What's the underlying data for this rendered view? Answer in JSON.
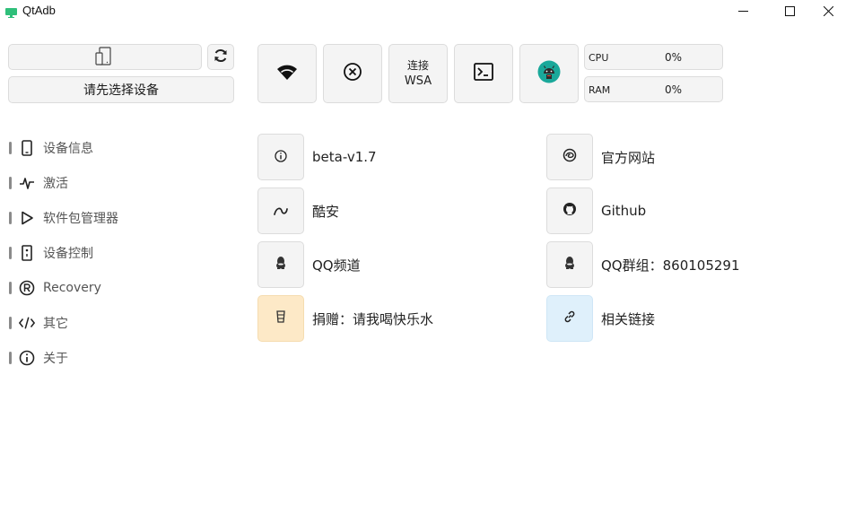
{
  "window": {
    "title": "QtAdb",
    "icon": "monitor-icon",
    "controls": [
      "minimize-icon",
      "maximize-icon",
      "close-icon"
    ]
  },
  "device": {
    "device_icon": "phone-outline-icon",
    "refresh_icon": "refresh-icon",
    "select_label": "请先选择设备"
  },
  "sidebar": {
    "items": [
      {
        "label": "设备信息",
        "icon": "phone-icon"
      },
      {
        "label": "激活",
        "icon": "pulse-icon"
      },
      {
        "label": "软件包管理器",
        "icon": "play-icon"
      },
      {
        "label": "设备控制",
        "icon": "remote-icon"
      },
      {
        "label": "Recovery",
        "icon": "registered-icon"
      },
      {
        "label": "其它",
        "icon": "code-icon"
      },
      {
        "label": "关于",
        "icon": "info-icon"
      }
    ]
  },
  "toolbar": {
    "wifi_icon": "wifi-icon",
    "disconnect_icon": "close-circle-icon",
    "wsa_line1": "连接",
    "wsa_line2": "WSA",
    "terminal_icon": "terminal-icon",
    "android_icon": "android-head-icon"
  },
  "stats": {
    "cpu_label": "CPU",
    "cpu_value": "0%",
    "ram_label": "RAM",
    "ram_value": "0%"
  },
  "about": {
    "left": [
      {
        "label": "beta-v1.7",
        "icon": "info-icon"
      },
      {
        "label": "酷安",
        "icon": "coolapk-icon"
      },
      {
        "label": "QQ频道",
        "icon": "qq-icon"
      },
      {
        "label": "捐赠：请我喝快乐水",
        "icon": "cup-icon"
      }
    ],
    "right": [
      {
        "label": "官方网站",
        "icon": "edge-icon"
      },
      {
        "label": "Github",
        "icon": "github-icon"
      },
      {
        "label": "QQ群组：860105291",
        "icon": "qq-icon"
      },
      {
        "label": "相关链接",
        "icon": "link-icon"
      }
    ]
  },
  "colors": {
    "donate_box": "#fde9c7",
    "link_box": "#dff0fb",
    "android_badge": "#1aa89a"
  }
}
